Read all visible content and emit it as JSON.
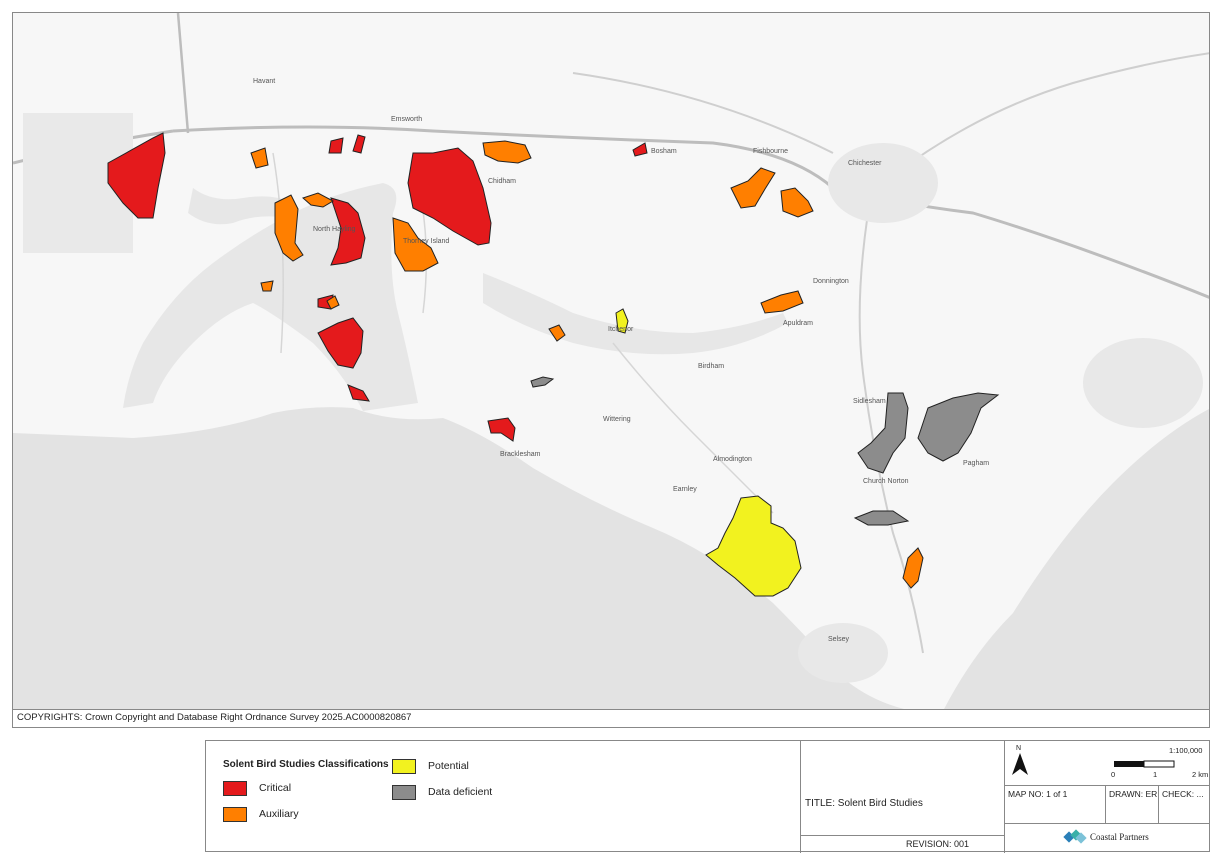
{
  "map": {
    "places": [
      "Emsworth",
      "Chichester",
      "Bosham",
      "Fishbourne",
      "Chidham",
      "Selsey",
      "Sidlesham",
      "Birdham",
      "Itchenor",
      "Wittering",
      "Earnley",
      "Havant",
      "Thorney Island",
      "North Hayling",
      "Almodington",
      "Church Norton",
      "Pagham",
      "Bracklesham",
      "Donnington",
      "Apuldram"
    ],
    "colors": {
      "critical": "#e41a1c",
      "auxiliary": "#ff7f00",
      "potential": "#f2f21f",
      "data_deficient": "#8c8c8c",
      "sea": "#e3e3e3",
      "land": "#f7f7f7"
    }
  },
  "copyright": "COPYRIGHTS: Crown Copyright and Database Right Ordnance Survey 2025.AC0000820867",
  "legend": {
    "title": "Solent Bird Studies Classifications",
    "items": [
      {
        "label": "Critical",
        "color": "#e41a1c"
      },
      {
        "label": "Auxiliary",
        "color": "#ff7f00"
      },
      {
        "label": "Potential",
        "color": "#f2f21f"
      },
      {
        "label": "Data deficient",
        "color": "#8c8c8c"
      }
    ]
  },
  "title_block": {
    "title": "TITLE: Solent Bird Studies",
    "revision": "REVISION: 001",
    "north_symbol": "N",
    "scale": "1:100,000",
    "scale_ticks": [
      "0",
      "1",
      "2 km"
    ],
    "map_no": "MAP NO: 1 of 1",
    "drawn": "DRAWN: ER",
    "check": "CHECK: ...",
    "company": "Coastal Partners",
    "icons": [
      "north-arrow-icon",
      "coastal-partners-logo-icon"
    ]
  }
}
